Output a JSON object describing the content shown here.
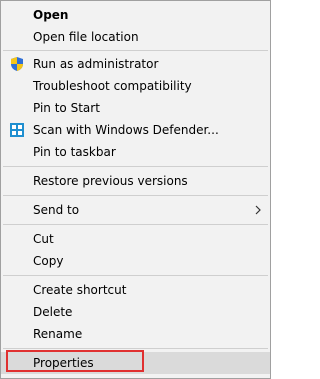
{
  "menu": {
    "open": "Open",
    "open_file_location": "Open file location",
    "run_as_admin": "Run as administrator",
    "troubleshoot": "Troubleshoot compatibility",
    "pin_to_start": "Pin to Start",
    "scan_defender": "Scan with Windows Defender...",
    "pin_to_taskbar": "Pin to taskbar",
    "restore_versions": "Restore previous versions",
    "send_to": "Send to",
    "cut": "Cut",
    "copy": "Copy",
    "create_shortcut": "Create shortcut",
    "delete": "Delete",
    "rename": "Rename",
    "properties": "Properties"
  },
  "icons": {
    "run_as_admin": "uac-shield-icon",
    "scan_defender": "windows-defender-icon",
    "send_to": "chevron-right-icon"
  },
  "colors": {
    "menu_background": "#f2f2f2",
    "hover_background": "#dadada",
    "highlight_border": "#e03030",
    "shield_blue": "#2f6fd6",
    "shield_yellow": "#f5c518"
  }
}
